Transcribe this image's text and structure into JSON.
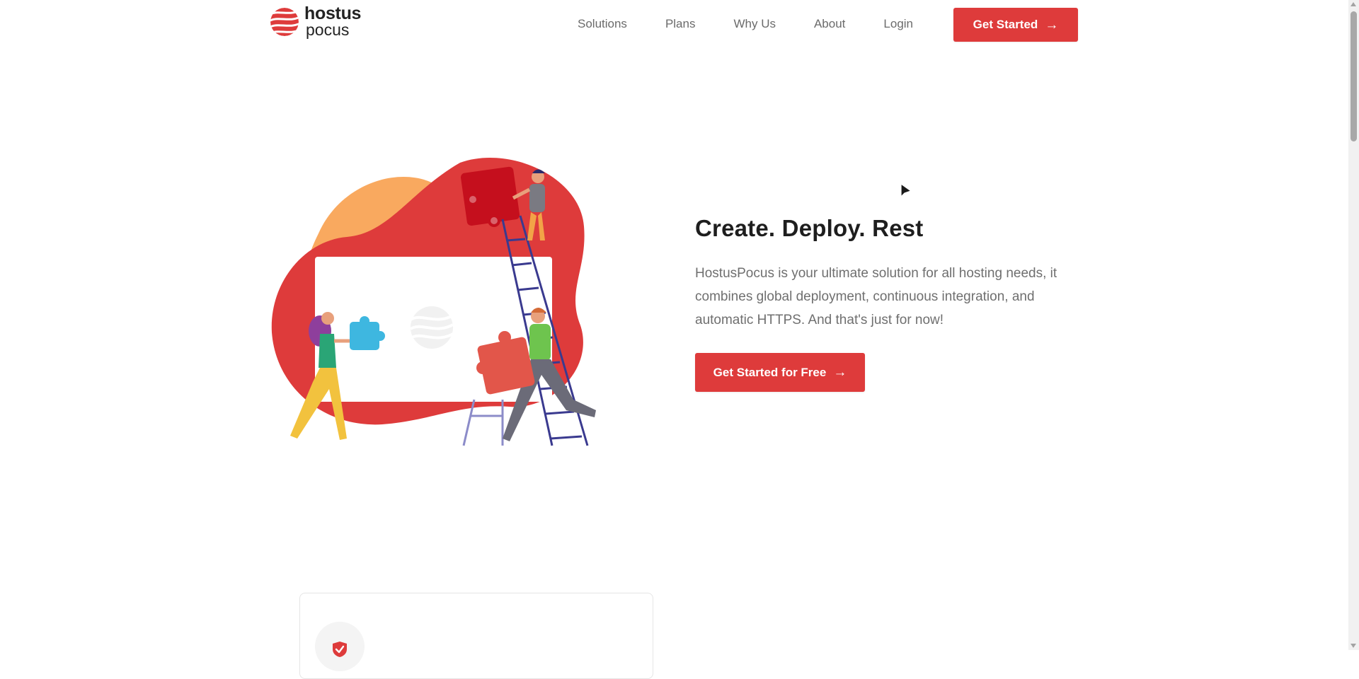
{
  "brand": {
    "name_line1": "hostus",
    "name_line2": "pocus",
    "color": "#de3b3b",
    "logo_icon": "striped-sphere-icon"
  },
  "nav": {
    "items": [
      {
        "label": "Solutions"
      },
      {
        "label": "Plans"
      },
      {
        "label": "Why Us"
      },
      {
        "label": "About"
      },
      {
        "label": "Login"
      }
    ],
    "cta_label": "Get Started",
    "cta_icon": "arrow-right-icon"
  },
  "hero": {
    "title": "Create. Deploy. Rest",
    "description": "HostusPocus is your ultimate solution for all hosting needs, it combines global deployment, continuous integration, and automatic HTTPS. And that's just for now!",
    "cta_label": "Get Started for Free",
    "cta_icon": "arrow-right-icon",
    "illustration": "team-assembling-puzzle-illustration"
  },
  "feature_card": {
    "icon": "shield-check-icon"
  },
  "colors": {
    "accent": "#de3b3b",
    "text_dark": "#1e1e1e",
    "text_muted": "#6f6f6f",
    "blob_orange": "#f9a95f",
    "puzzle_blue": "#3eb7e0"
  }
}
